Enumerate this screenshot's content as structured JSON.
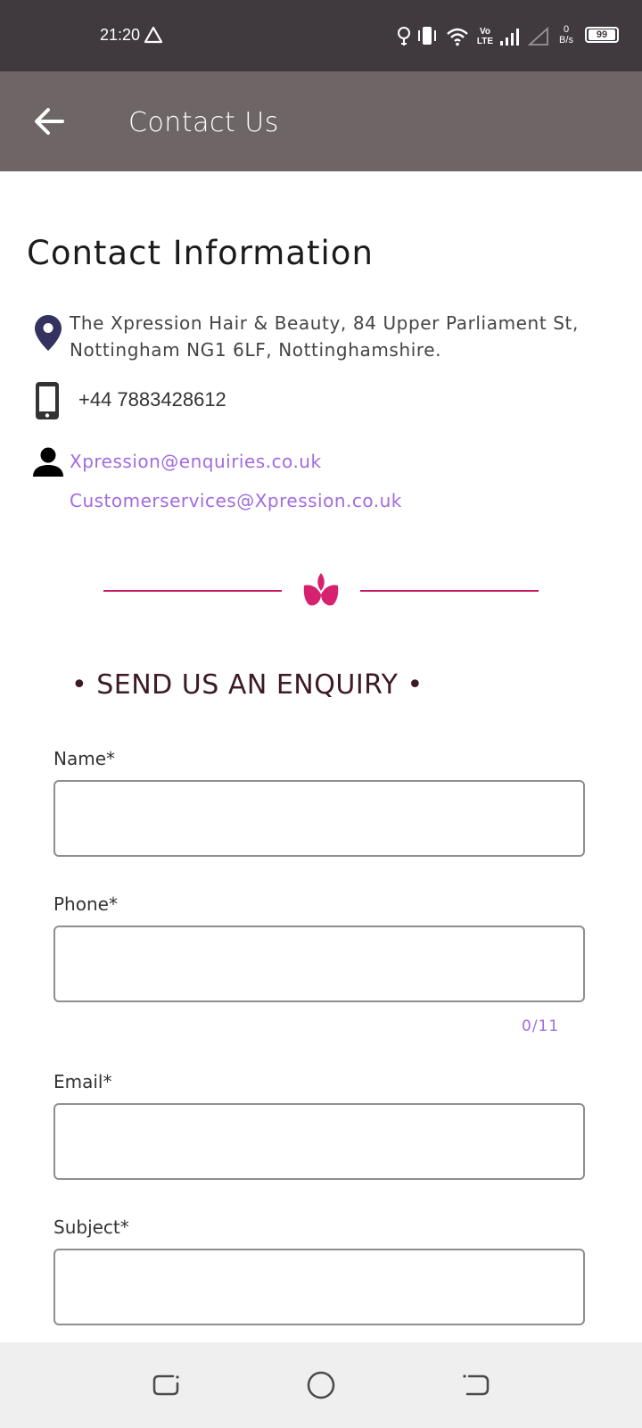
{
  "status_bar": {
    "time": "21:20",
    "data_speed_value": "0",
    "data_speed_unit": "B/s",
    "network_label": "Vo LTE",
    "battery": "99"
  },
  "app_bar": {
    "title": "Contact Us",
    "back_icon": "arrow-left-icon",
    "background": "#6e6666"
  },
  "contact": {
    "heading": "Contact Information",
    "address": "The Xpression Hair & Beauty, 84 Upper Parliament St, Nottingham NG1 6LF, Nottinghamshire.",
    "phone": "+44 7883428612",
    "emails": [
      "Xpression@enquiries.co.uk",
      "Customerservices@Xpression.co.uk"
    ],
    "icons": [
      "location-pin-icon",
      "phone-icon",
      "person-icon"
    ],
    "link_color": "#a26be0"
  },
  "enquiry": {
    "heading": "• SEND US AN ENQUIRY •",
    "accent_color": "#c4195f"
  },
  "form": {
    "name_label": "Name*",
    "phone_label": "Phone*",
    "phone_counter": "0/11",
    "email_label": "Email*",
    "subject_label": "Subject*"
  },
  "nav_bar": {
    "buttons": [
      "recents-icon",
      "home-icon",
      "back-nav-icon"
    ]
  }
}
